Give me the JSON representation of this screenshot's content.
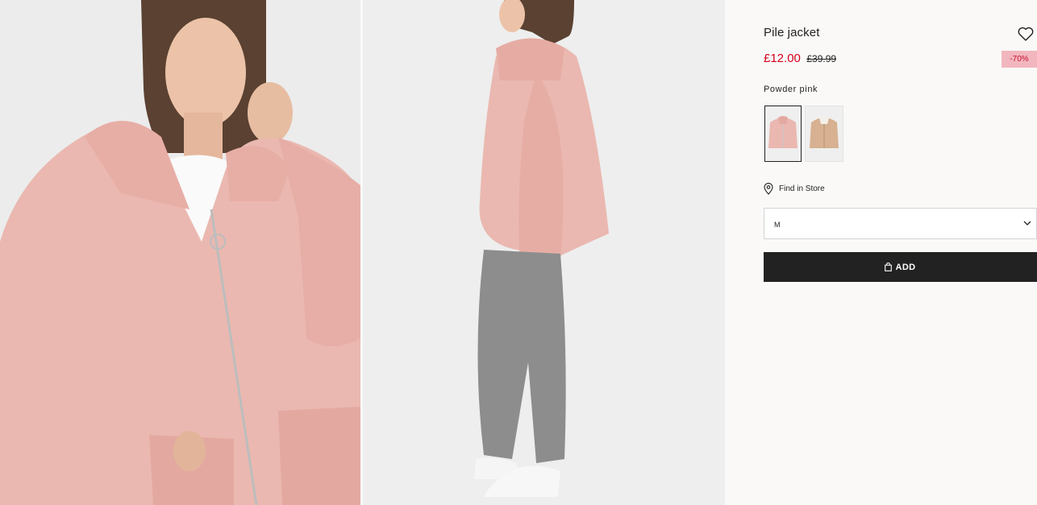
{
  "product": {
    "title": "Pile jacket",
    "price_current": "£12.00",
    "price_original": "£39.99",
    "discount_badge": "-70%",
    "color_name": "Powder pink"
  },
  "swatches": [
    {
      "color": "#e9b9b2",
      "selected": true
    },
    {
      "color": "#d7b191",
      "selected": false
    }
  ],
  "find_in_store": {
    "label": "Find in Store",
    "icon": "location-pin-icon"
  },
  "size_select": {
    "value": "M",
    "icon": "chevron-down-icon"
  },
  "add_button": {
    "label": "ADD",
    "icon": "shopping-bag-icon"
  },
  "favorite": {
    "icon": "heart-icon"
  },
  "colors": {
    "price_sale": "#d6001c",
    "badge_bg": "#f2b7be",
    "button_bg": "#222222",
    "jacket_pink": "#eab8b0",
    "trousers_grey": "#8d8d8d"
  }
}
